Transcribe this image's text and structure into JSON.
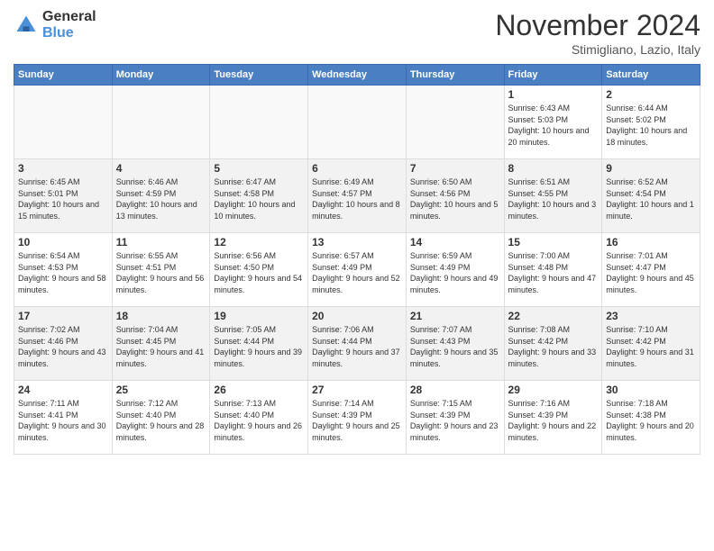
{
  "header": {
    "logo_general": "General",
    "logo_blue": "Blue",
    "month_title": "November 2024",
    "location": "Stimigliano, Lazio, Italy"
  },
  "days_of_week": [
    "Sunday",
    "Monday",
    "Tuesday",
    "Wednesday",
    "Thursday",
    "Friday",
    "Saturday"
  ],
  "weeks": [
    [
      {
        "day": "",
        "info": ""
      },
      {
        "day": "",
        "info": ""
      },
      {
        "day": "",
        "info": ""
      },
      {
        "day": "",
        "info": ""
      },
      {
        "day": "",
        "info": ""
      },
      {
        "day": "1",
        "info": "Sunrise: 6:43 AM\nSunset: 5:03 PM\nDaylight: 10 hours and 20 minutes."
      },
      {
        "day": "2",
        "info": "Sunrise: 6:44 AM\nSunset: 5:02 PM\nDaylight: 10 hours and 18 minutes."
      }
    ],
    [
      {
        "day": "3",
        "info": "Sunrise: 6:45 AM\nSunset: 5:01 PM\nDaylight: 10 hours and 15 minutes."
      },
      {
        "day": "4",
        "info": "Sunrise: 6:46 AM\nSunset: 4:59 PM\nDaylight: 10 hours and 13 minutes."
      },
      {
        "day": "5",
        "info": "Sunrise: 6:47 AM\nSunset: 4:58 PM\nDaylight: 10 hours and 10 minutes."
      },
      {
        "day": "6",
        "info": "Sunrise: 6:49 AM\nSunset: 4:57 PM\nDaylight: 10 hours and 8 minutes."
      },
      {
        "day": "7",
        "info": "Sunrise: 6:50 AM\nSunset: 4:56 PM\nDaylight: 10 hours and 5 minutes."
      },
      {
        "day": "8",
        "info": "Sunrise: 6:51 AM\nSunset: 4:55 PM\nDaylight: 10 hours and 3 minutes."
      },
      {
        "day": "9",
        "info": "Sunrise: 6:52 AM\nSunset: 4:54 PM\nDaylight: 10 hours and 1 minute."
      }
    ],
    [
      {
        "day": "10",
        "info": "Sunrise: 6:54 AM\nSunset: 4:53 PM\nDaylight: 9 hours and 58 minutes."
      },
      {
        "day": "11",
        "info": "Sunrise: 6:55 AM\nSunset: 4:51 PM\nDaylight: 9 hours and 56 minutes."
      },
      {
        "day": "12",
        "info": "Sunrise: 6:56 AM\nSunset: 4:50 PM\nDaylight: 9 hours and 54 minutes."
      },
      {
        "day": "13",
        "info": "Sunrise: 6:57 AM\nSunset: 4:49 PM\nDaylight: 9 hours and 52 minutes."
      },
      {
        "day": "14",
        "info": "Sunrise: 6:59 AM\nSunset: 4:49 PM\nDaylight: 9 hours and 49 minutes."
      },
      {
        "day": "15",
        "info": "Sunrise: 7:00 AM\nSunset: 4:48 PM\nDaylight: 9 hours and 47 minutes."
      },
      {
        "day": "16",
        "info": "Sunrise: 7:01 AM\nSunset: 4:47 PM\nDaylight: 9 hours and 45 minutes."
      }
    ],
    [
      {
        "day": "17",
        "info": "Sunrise: 7:02 AM\nSunset: 4:46 PM\nDaylight: 9 hours and 43 minutes."
      },
      {
        "day": "18",
        "info": "Sunrise: 7:04 AM\nSunset: 4:45 PM\nDaylight: 9 hours and 41 minutes."
      },
      {
        "day": "19",
        "info": "Sunrise: 7:05 AM\nSunset: 4:44 PM\nDaylight: 9 hours and 39 minutes."
      },
      {
        "day": "20",
        "info": "Sunrise: 7:06 AM\nSunset: 4:44 PM\nDaylight: 9 hours and 37 minutes."
      },
      {
        "day": "21",
        "info": "Sunrise: 7:07 AM\nSunset: 4:43 PM\nDaylight: 9 hours and 35 minutes."
      },
      {
        "day": "22",
        "info": "Sunrise: 7:08 AM\nSunset: 4:42 PM\nDaylight: 9 hours and 33 minutes."
      },
      {
        "day": "23",
        "info": "Sunrise: 7:10 AM\nSunset: 4:42 PM\nDaylight: 9 hours and 31 minutes."
      }
    ],
    [
      {
        "day": "24",
        "info": "Sunrise: 7:11 AM\nSunset: 4:41 PM\nDaylight: 9 hours and 30 minutes."
      },
      {
        "day": "25",
        "info": "Sunrise: 7:12 AM\nSunset: 4:40 PM\nDaylight: 9 hours and 28 minutes."
      },
      {
        "day": "26",
        "info": "Sunrise: 7:13 AM\nSunset: 4:40 PM\nDaylight: 9 hours and 26 minutes."
      },
      {
        "day": "27",
        "info": "Sunrise: 7:14 AM\nSunset: 4:39 PM\nDaylight: 9 hours and 25 minutes."
      },
      {
        "day": "28",
        "info": "Sunrise: 7:15 AM\nSunset: 4:39 PM\nDaylight: 9 hours and 23 minutes."
      },
      {
        "day": "29",
        "info": "Sunrise: 7:16 AM\nSunset: 4:39 PM\nDaylight: 9 hours and 22 minutes."
      },
      {
        "day": "30",
        "info": "Sunrise: 7:18 AM\nSunset: 4:38 PM\nDaylight: 9 hours and 20 minutes."
      }
    ]
  ]
}
